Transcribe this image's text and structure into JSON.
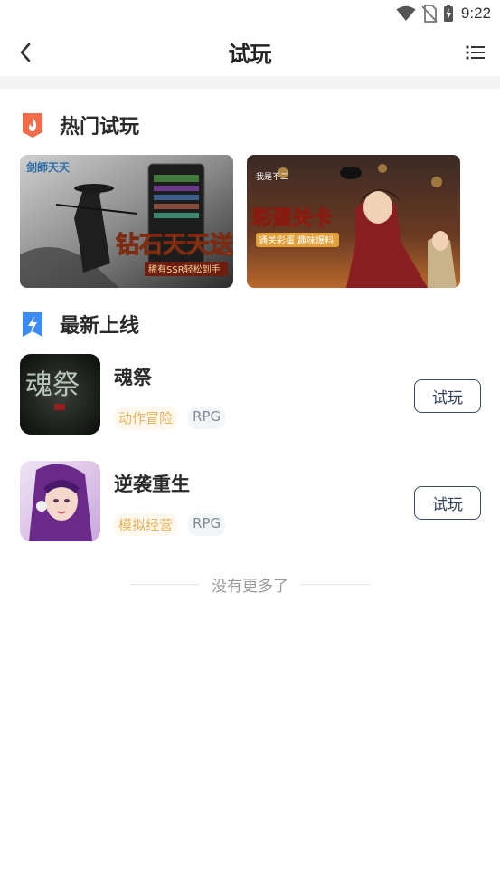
{
  "status_bar": {
    "time": "9:22",
    "icons": [
      "wifi-icon",
      "no-sim-icon",
      "battery-charging-icon"
    ]
  },
  "nav": {
    "title": "试玩",
    "back_icon": "chevron-left-icon",
    "menu_icon": "list-icon"
  },
  "hot_section": {
    "title": "热门试玩",
    "icon": "flame-icon",
    "banners": [
      {
        "logo_text": "剑師天天",
        "headline": "钻石天天送",
        "subline": "稀有SSR轻松到手"
      },
      {
        "logo_text": "我是不二",
        "headline": "彩蛋关卡",
        "subline": "通关彩蛋 趣味爆料"
      }
    ]
  },
  "new_section": {
    "title": "最新上线",
    "icon": "lightning-bookmark-icon",
    "games": [
      {
        "name": "魂祭",
        "icon_text": "魂祭",
        "genre": "动作冒险",
        "type": "RPG",
        "button": "试玩"
      },
      {
        "name": "逆袭重生",
        "genre": "模拟经营",
        "type": "RPG",
        "button": "试玩"
      }
    ]
  },
  "footer": {
    "no_more_text": "没有更多了"
  },
  "colors": {
    "accent_fire": "#f26b4a",
    "accent_blue": "#3b8df5",
    "tag_genre": "#e8b25c",
    "tag_type": "#7c8a9a",
    "button_border": "#3a4a66"
  }
}
